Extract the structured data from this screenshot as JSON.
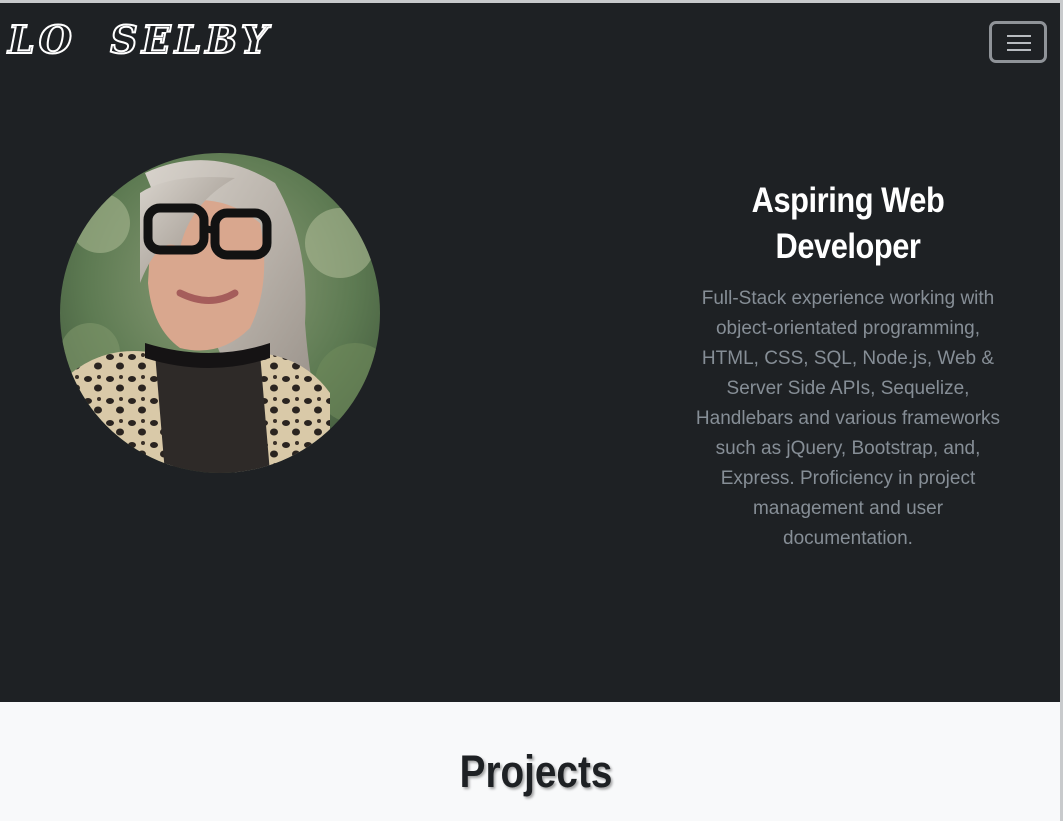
{
  "navbar": {
    "brand": "LO  SELBY",
    "toggler_icon": "hamburger-menu-icon"
  },
  "hero": {
    "avatar_icon": "profile-photo",
    "title": "Aspiring Web Developer",
    "description": "Full-Stack experience working with object-orientated programming, HTML, CSS, SQL, Node.js, Web & Server Side APIs, Sequelize, Handlebars and various frameworks such as jQuery, Bootstrap, and, Express. Proficiency in project management and user documentation."
  },
  "projects": {
    "heading": "Projects"
  },
  "colors": {
    "hero_background": "#1e2124",
    "section_background": "#f8f9fa",
    "muted_text": "#868e96",
    "white": "#ffffff"
  }
}
